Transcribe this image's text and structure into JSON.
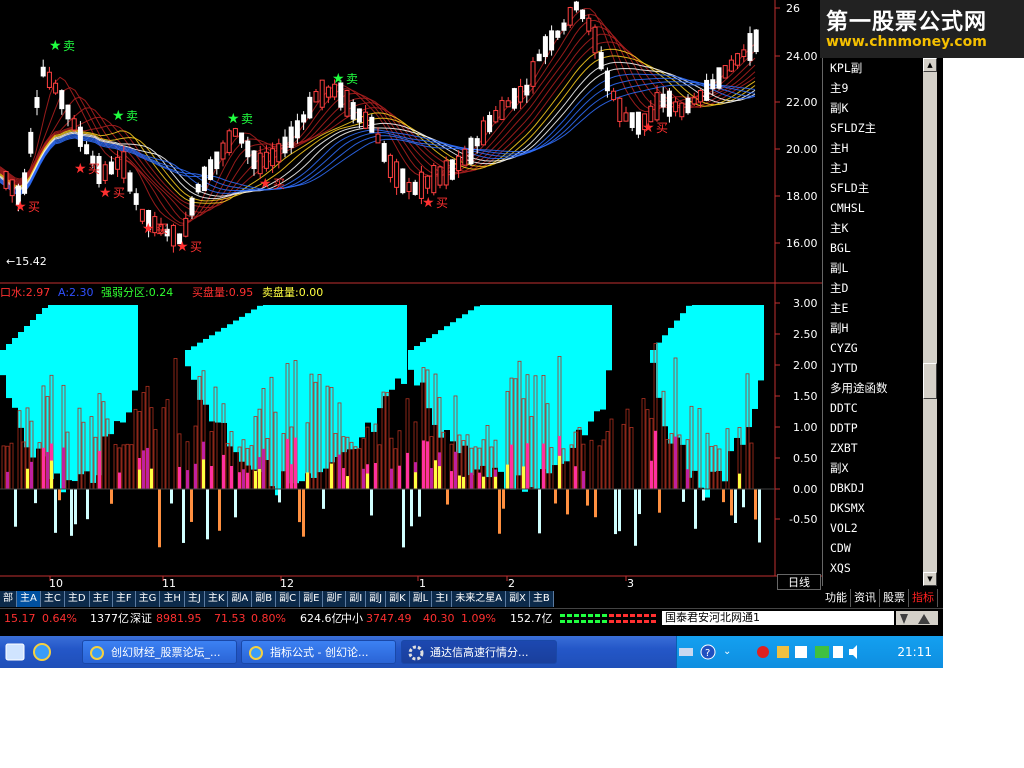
{
  "watermark": {
    "title": "第一股票公式网",
    "url": "www.chnmoney.com"
  },
  "price_chart": {
    "y_ticks": [
      "26",
      "24.00",
      "22.00",
      "20.00",
      "18.00",
      "16.00"
    ],
    "low_marker": "←15.42",
    "sell_signal": "卖",
    "buy_signal": "买"
  },
  "indicator_chart": {
    "legend": [
      {
        "text": "口水:2.97",
        "color": "#ff3030"
      },
      {
        "text": "A:2.30",
        "color": "#3050ff"
      },
      {
        "text": "强弱分区:0.24",
        "color": "#30ff30"
      },
      {
        "text": "买盘量:0.95",
        "color": "#ff3030"
      },
      {
        "text": "卖盘量:0.00",
        "color": "#ffff40"
      }
    ],
    "y_ticks": [
      "3.00",
      "2.50",
      "2.00",
      "1.50",
      "1.00",
      "0.50",
      "0.00",
      "-0.50"
    ]
  },
  "date_axis": {
    "labels": [
      "10",
      "11",
      "12",
      "1",
      "2",
      "3"
    ]
  },
  "period_label": "日线",
  "indicator_list": [
    "KPL副",
    "主9",
    "副K",
    "SFLDZ主",
    "主H",
    "主J",
    "SFLD主",
    "CMHSL",
    "主K",
    "BGL",
    "副L",
    "主D",
    "主E",
    "副H",
    "CYZG",
    "JYTD",
    "多用途函数",
    "DDTC",
    "DDTP",
    "ZXBT",
    "副X",
    "DBKDJ",
    "DKSMX",
    "VOL2",
    "CDW",
    "XQS"
  ],
  "side_tabs": [
    "功能",
    "资讯",
    "股票",
    "指标"
  ],
  "formula_tabs": [
    "部",
    "主A",
    "主C",
    "主D",
    "主E",
    "主F",
    "主G",
    "主H",
    "主J",
    "主K",
    "副A",
    "副B",
    "副C",
    "副E",
    "副F",
    "副I",
    "副J",
    "副K",
    "副L",
    "主I",
    "未来之星A",
    "副X",
    "主B"
  ],
  "status": {
    "sh_index": "15.17",
    "sh_pct": "0.64%",
    "sh_amount": "1377亿",
    "sz_label": "深证",
    "sz_index": "8981.95",
    "sz_change": "71.53",
    "sz_pct": "0.80%",
    "sz_amount": "624.6亿",
    "zx_label": "中小",
    "zx_index": "3747.49",
    "zx_change": "40.30",
    "zx_pct": "1.09%",
    "zx_amount": "152.7亿",
    "news": "国泰君安河北网通1"
  },
  "taskbar": {
    "windows": [
      "创幻财经_股票论坛_...",
      "指标公式 - 创幻论...",
      "通达信高速行情分..."
    ],
    "clock": "21:11"
  },
  "colors": {
    "background": "#000000",
    "axis": "#c03030",
    "cyan": "#00ffff",
    "candle_up": "#ff4040",
    "taskbar": "#2457c8"
  }
}
